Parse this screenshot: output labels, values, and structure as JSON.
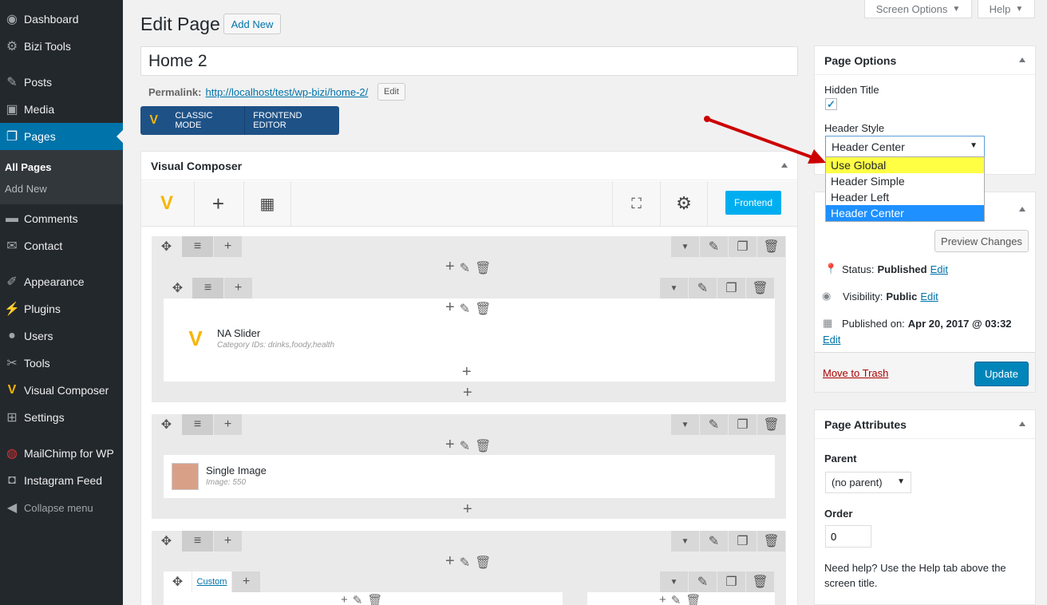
{
  "sidebar": {
    "items": [
      {
        "label": "Dashboard",
        "icon": "dashboard-icon",
        "glyph": "◉"
      },
      {
        "label": "Bizi Tools",
        "icon": "gear-icon",
        "glyph": "⚙"
      },
      {
        "label": "Posts",
        "icon": "pin-icon",
        "glyph": "✎"
      },
      {
        "label": "Media",
        "icon": "media-icon",
        "glyph": "▣"
      },
      {
        "label": "Pages",
        "icon": "pages-icon",
        "glyph": "❐"
      },
      {
        "label": "Comments",
        "icon": "comment-icon",
        "glyph": "▬"
      },
      {
        "label": "Contact",
        "icon": "mail-icon",
        "glyph": "✉"
      },
      {
        "label": "Appearance",
        "icon": "brush-icon",
        "glyph": "✐"
      },
      {
        "label": "Plugins",
        "icon": "plugin-icon",
        "glyph": "⚡"
      },
      {
        "label": "Users",
        "icon": "user-icon",
        "glyph": "●"
      },
      {
        "label": "Tools",
        "icon": "wrench-icon",
        "glyph": "✂"
      },
      {
        "label": "Visual Composer",
        "icon": "vc-icon",
        "glyph": "V"
      },
      {
        "label": "Settings",
        "icon": "settings-icon",
        "glyph": "⊞"
      },
      {
        "label": "MailChimp for WP",
        "icon": "mailchimp-icon",
        "glyph": "◍"
      },
      {
        "label": "Instagram Feed",
        "icon": "camera-icon",
        "glyph": "◘"
      },
      {
        "label": "Collapse menu",
        "icon": "collapse-icon",
        "glyph": "◀"
      }
    ],
    "submenu": [
      "All Pages",
      "Add New"
    ]
  },
  "top": {
    "screen_options": "Screen Options",
    "help": "Help"
  },
  "header": {
    "title": "Edit Page",
    "add_new": "Add New"
  },
  "editor": {
    "page_title": "Home 2",
    "permalink_label": "Permalink:",
    "permalink_base": "http://localhost/test/wp-bizi/",
    "permalink_slug": "home-2",
    "permalink_end": "/",
    "edit": "Edit",
    "classic_mode": "CLASSIC MODE",
    "frontend_editor": "FRONTEND EDITOR"
  },
  "vc": {
    "title": "Visual Composer",
    "frontend": "Frontend",
    "slider": {
      "name": "NA Slider",
      "desc": "Category IDs: drinks,foody,health"
    },
    "image": {
      "name": "Single Image",
      "desc": "Image: 550"
    },
    "custom": "Custom"
  },
  "page_options": {
    "title": "Page Options",
    "hidden_title": "Hidden Title",
    "header_style": "Header Style",
    "selected": "Header Center",
    "options": [
      "Use Global",
      "Header Simple",
      "Header Left",
      "Header Center"
    ]
  },
  "publish": {
    "preview": "Preview Changes",
    "status_label": "Status:",
    "status": "Published",
    "visibility_label": "Visibility:",
    "visibility": "Public",
    "published_label": "Published on:",
    "published": "Apr 20, 2017 @ 03:32",
    "edit": "Edit",
    "trash": "Move to Trash",
    "update": "Update"
  },
  "attributes": {
    "title": "Page Attributes",
    "parent_label": "Parent",
    "parent": "(no parent)",
    "order_label": "Order",
    "order": "0",
    "help": "Need help? Use the Help tab above the screen title."
  },
  "colors": {
    "accent": "#0073aa",
    "frontend": "#00aef0",
    "highlight": "#ffff44",
    "arrow": "#cc0000"
  }
}
